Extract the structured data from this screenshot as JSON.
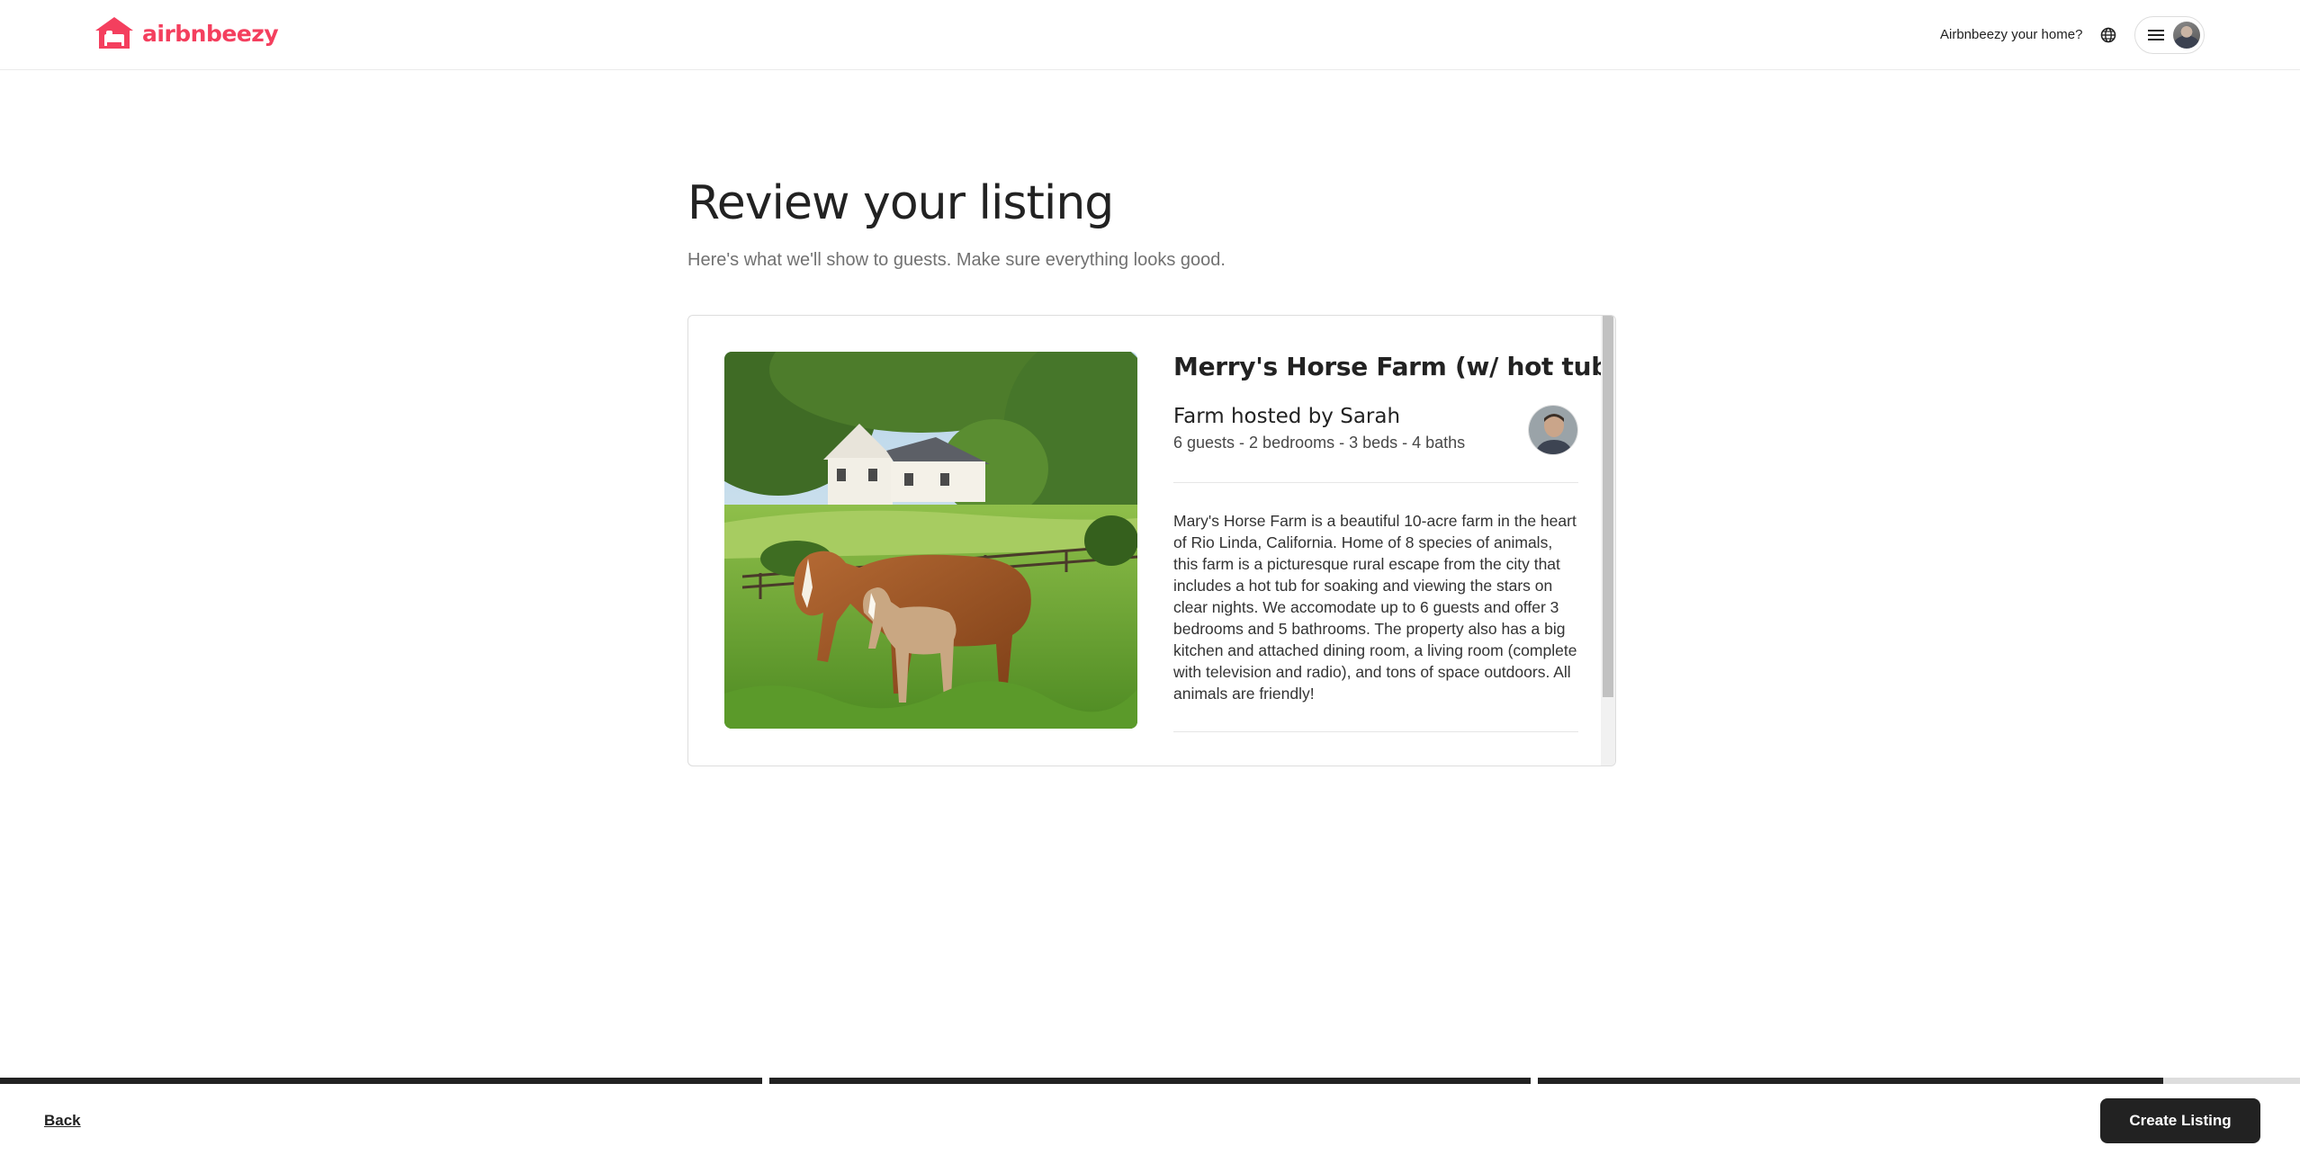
{
  "header": {
    "brand": "airbnbeezy",
    "brand_color": "#f43f5e",
    "host_link": "Airbnbeezy your home?",
    "icons": [
      "logo-house-icon",
      "globe-icon",
      "hamburger-icon"
    ]
  },
  "main": {
    "title": "Review your listing",
    "subtitle": "Here's what we'll show to guests. Make sure everything looks good."
  },
  "listing": {
    "title": "Merry's Horse Farm (w/ hot tub!)",
    "host_line": "Farm hosted by Sarah",
    "details": "6 guests - 2 bedrooms - 3 beds - 4 baths",
    "description": "Mary's Horse Farm is a beautiful 10-acre farm in the heart of Rio Linda, California. Home of 8 species of animals, this farm is a picturesque rural escape from the city that includes a hot tub for soaking and viewing the stars on clear nights. We accomodate up to 6 guests and offer 3 bedrooms and 5 bathrooms. The property also has a big kitchen and attached dining room, a living room (complete with television and radio), and tons of space outdoors. All animals are friendly!"
  },
  "progress": {
    "steps": [
      1.0,
      1.0,
      0.82
    ]
  },
  "footer": {
    "back_label": "Back",
    "create_label": "Create Listing"
  }
}
